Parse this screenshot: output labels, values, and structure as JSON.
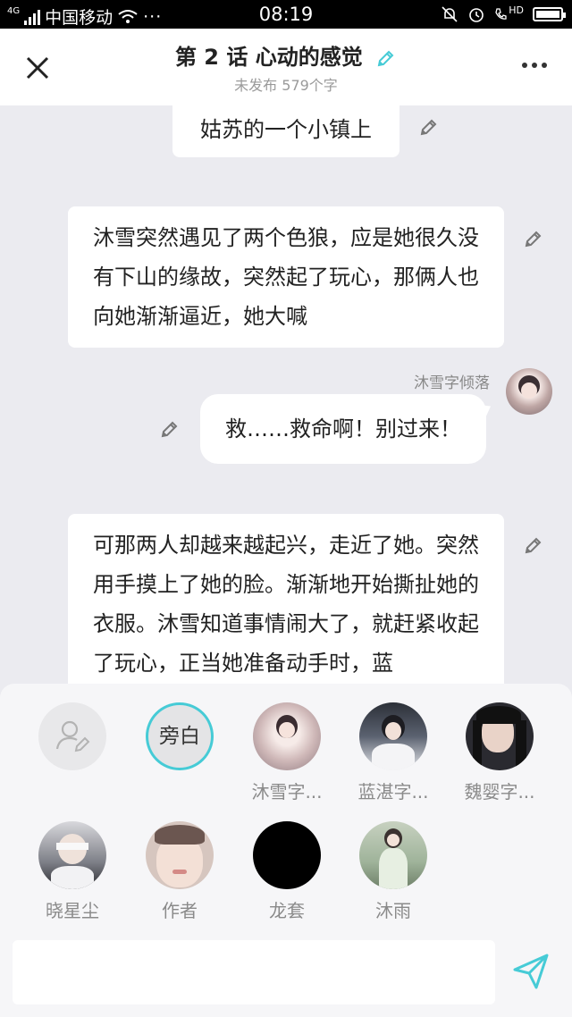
{
  "status": {
    "network": "4G",
    "carrier": "中国移动",
    "time": "08:19",
    "hd": "HD"
  },
  "header": {
    "title": "第 2 话 心动的感觉",
    "subtitle": "未发布 579个字",
    "accent": "#46cbd6"
  },
  "messages": [
    {
      "type": "narration",
      "text": "姑苏的一个小镇上"
    },
    {
      "type": "narration",
      "text": "沐雪突然遇见了两个色狼，应是她很久没有下山的缘故，突然起了玩心，那俩人也向她渐渐逼近，她大喊"
    },
    {
      "type": "dialogue",
      "speaker": "沐雪字倾落",
      "text": "救……救命啊！别过来！"
    },
    {
      "type": "narration",
      "text": "可那两人却越来越起兴，走近了她。突然用手摸上了她的脸。渐渐地开始撕扯她的衣服。沐雪知道事情闹大了，就赶紧收起了玩心，正当她准备动手时，蓝"
    }
  ],
  "characters": [
    {
      "name": "",
      "icon": "add-character-icon"
    },
    {
      "name": "",
      "avatar_text": "旁白",
      "selected": true
    },
    {
      "name": "沐雪字...",
      "color": "#cfb8b8"
    },
    {
      "name": "蓝湛字...",
      "color": "#5b6270"
    },
    {
      "name": "魏婴字...",
      "color": "#2a2a30"
    },
    {
      "name": "晓星尘",
      "color": "#7e8088"
    },
    {
      "name": "作者",
      "color": "#e8d0c6"
    },
    {
      "name": "龙套",
      "color": "#000000"
    },
    {
      "name": "沐雨",
      "color": "#9fb39a"
    }
  ],
  "composer": {
    "placeholder": "",
    "send_color": "#46cbd6"
  }
}
